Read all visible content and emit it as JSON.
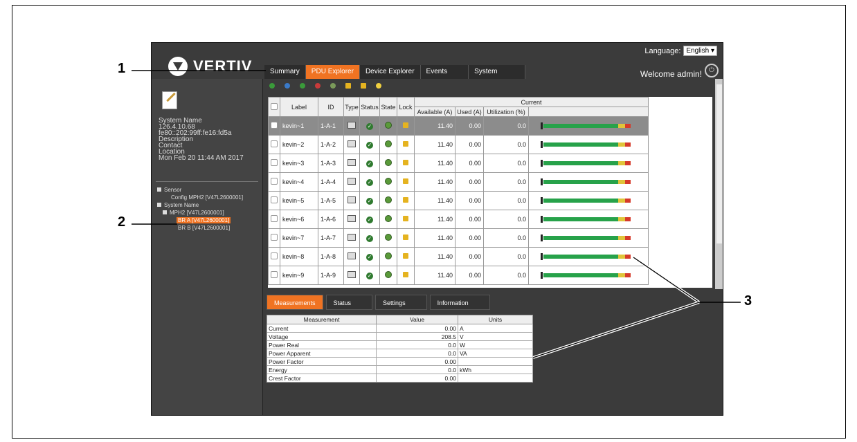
{
  "header": {
    "brand": "VERTIV",
    "language_label": "Language:",
    "language_value": "English ▾",
    "welcome": "Welcome admin!"
  },
  "tabs": [
    "Summary",
    "PDU Explorer",
    "Device Explorer",
    "Events",
    "System"
  ],
  "active_tab": "PDU Explorer",
  "system_info": {
    "name": "System Name",
    "ip": "126.4.10.68",
    "ipv6": "fe80::202:99ff:fe16:fd5a",
    "description": "Description",
    "contact": "Contact",
    "location": "Location",
    "datetime": "Mon Feb 20 11:44 AM 2017"
  },
  "tree": {
    "sensor": "Sensor",
    "config": "Config MPH2 [V47L2600001]",
    "system_name": "System Name",
    "mph2": "MPH2 [V47L2600001]",
    "br_a": "BR A [V47L2600001]",
    "br_b": "BR B [V47L2600001]"
  },
  "grid": {
    "headers": {
      "label": "Label",
      "id": "ID",
      "type": "Type",
      "status": "Status",
      "state": "State",
      "lock": "Lock",
      "current": "Current",
      "available": "Available (A)",
      "used": "Used (A)",
      "utilization": "Utilization (%)"
    },
    "rows": [
      {
        "label": "kevin~1",
        "id": "1-A-1",
        "available": "11.40",
        "used": "0.00",
        "util": "0.0"
      },
      {
        "label": "kevin~2",
        "id": "1-A-2",
        "available": "11.40",
        "used": "0.00",
        "util": "0.0"
      },
      {
        "label": "kevin~3",
        "id": "1-A-3",
        "available": "11.40",
        "used": "0.00",
        "util": "0.0"
      },
      {
        "label": "kevin~4",
        "id": "1-A-4",
        "available": "11.40",
        "used": "0.00",
        "util": "0.0"
      },
      {
        "label": "kevin~5",
        "id": "1-A-5",
        "available": "11.40",
        "used": "0.00",
        "util": "0.0"
      },
      {
        "label": "kevin~6",
        "id": "1-A-6",
        "available": "11.40",
        "used": "0.00",
        "util": "0.0"
      },
      {
        "label": "kevin~7",
        "id": "1-A-7",
        "available": "11.40",
        "used": "0.00",
        "util": "0.0"
      },
      {
        "label": "kevin~8",
        "id": "1-A-8",
        "available": "11.40",
        "used": "0.00",
        "util": "0.0"
      },
      {
        "label": "kevin~9",
        "id": "1-A-9",
        "available": "11.40",
        "used": "0.00",
        "util": "0.0"
      }
    ]
  },
  "bottom_tabs": [
    "Measurements",
    "Status",
    "Settings",
    "Information"
  ],
  "measurements": {
    "headers": {
      "m": "Measurement",
      "v": "Value",
      "u": "Units"
    },
    "rows": [
      {
        "m": "Current",
        "v": "0.00",
        "u": "A"
      },
      {
        "m": "Voltage",
        "v": "208.5",
        "u": "V"
      },
      {
        "m": "Power Real",
        "v": "0.0",
        "u": "W"
      },
      {
        "m": "Power Apparent",
        "v": "0.0",
        "u": "VA"
      },
      {
        "m": "Power Factor",
        "v": "0.00",
        "u": ""
      },
      {
        "m": "Energy",
        "v": "0.0",
        "u": "kWh"
      },
      {
        "m": "Crest Factor",
        "v": "0.00",
        "u": ""
      }
    ]
  },
  "callouts": [
    "1",
    "2",
    "3"
  ],
  "colors": {
    "accent": "#f07322",
    "panel": "#3b3b3b"
  }
}
